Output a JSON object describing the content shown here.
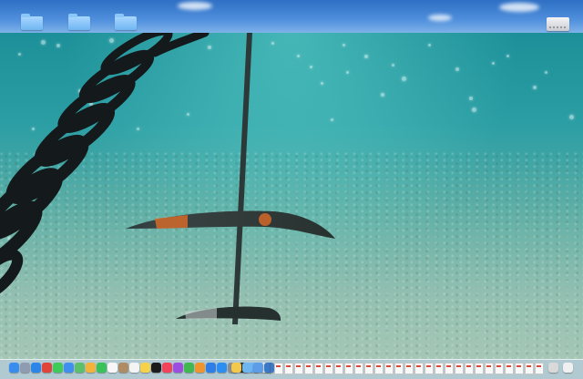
{
  "desktop": {
    "folders": [
      {
        "name": "folder-1",
        "color": "#7fc0f6"
      },
      {
        "name": "folder-2",
        "color": "#7fc0f6"
      },
      {
        "name": "folder-3",
        "color": "#7fc0f6"
      }
    ],
    "drive_icon": "external-drive-icon",
    "wallpaper": "underwater-hydrofoil-photo"
  },
  "dock": {
    "apps": [
      {
        "icon": "finder-icon",
        "color": "#3a8df0"
      },
      {
        "icon": "launchpad-icon",
        "color": "#8f9bb0"
      },
      {
        "icon": "safari-icon",
        "color": "#2c86e8"
      },
      {
        "icon": "chrome-icon",
        "color": "#e0453a"
      },
      {
        "icon": "messages-icon",
        "color": "#3ecb5a"
      },
      {
        "icon": "mail-icon",
        "color": "#3f8ff0"
      },
      {
        "icon": "maps-icon",
        "color": "#5cc06a"
      },
      {
        "icon": "photos-icon",
        "color": "#f2b33d"
      },
      {
        "icon": "facetime-icon",
        "color": "#39c25a"
      },
      {
        "icon": "calendar-icon",
        "color": "#f7f7f7"
      },
      {
        "icon": "contacts-icon",
        "color": "#b08c64"
      },
      {
        "icon": "reminders-icon",
        "color": "#f4f4f4"
      },
      {
        "icon": "notes-icon",
        "color": "#f6d24a"
      },
      {
        "icon": "tv-icon",
        "color": "#1c1c1e"
      },
      {
        "icon": "music-icon",
        "color": "#f2435b"
      },
      {
        "icon": "podcasts-icon",
        "color": "#9b4ee0"
      },
      {
        "icon": "numbers-icon",
        "color": "#3fb850"
      },
      {
        "icon": "pages-icon",
        "color": "#f0952e"
      },
      {
        "icon": "keynote-icon",
        "color": "#2f7ee8"
      },
      {
        "icon": "app-store-icon",
        "color": "#2c8ef0"
      },
      {
        "icon": "system-settings-icon",
        "color": "#8c8c93"
      },
      {
        "icon": "terminal-icon",
        "color": "#2a2a2a"
      },
      {
        "icon": "preview-icon",
        "color": "#6fb5f2"
      },
      {
        "icon": "textedit-icon",
        "color": "#e8e8e8"
      }
    ],
    "right_apps": [
      {
        "icon": "folder-icon",
        "color": "#f2c94c"
      },
      {
        "icon": "downloads-icon",
        "color": "#6fb5f2"
      },
      {
        "icon": "screenshot-icon",
        "color": "#5d9de8"
      },
      {
        "icon": "migration-icon",
        "color": "#3a78c8"
      }
    ],
    "document_count": 27,
    "trailing": [
      {
        "icon": "stack-icon",
        "color": "#d9d9d9"
      },
      {
        "icon": "trash-icon",
        "color": "#f0f0f0"
      }
    ]
  }
}
